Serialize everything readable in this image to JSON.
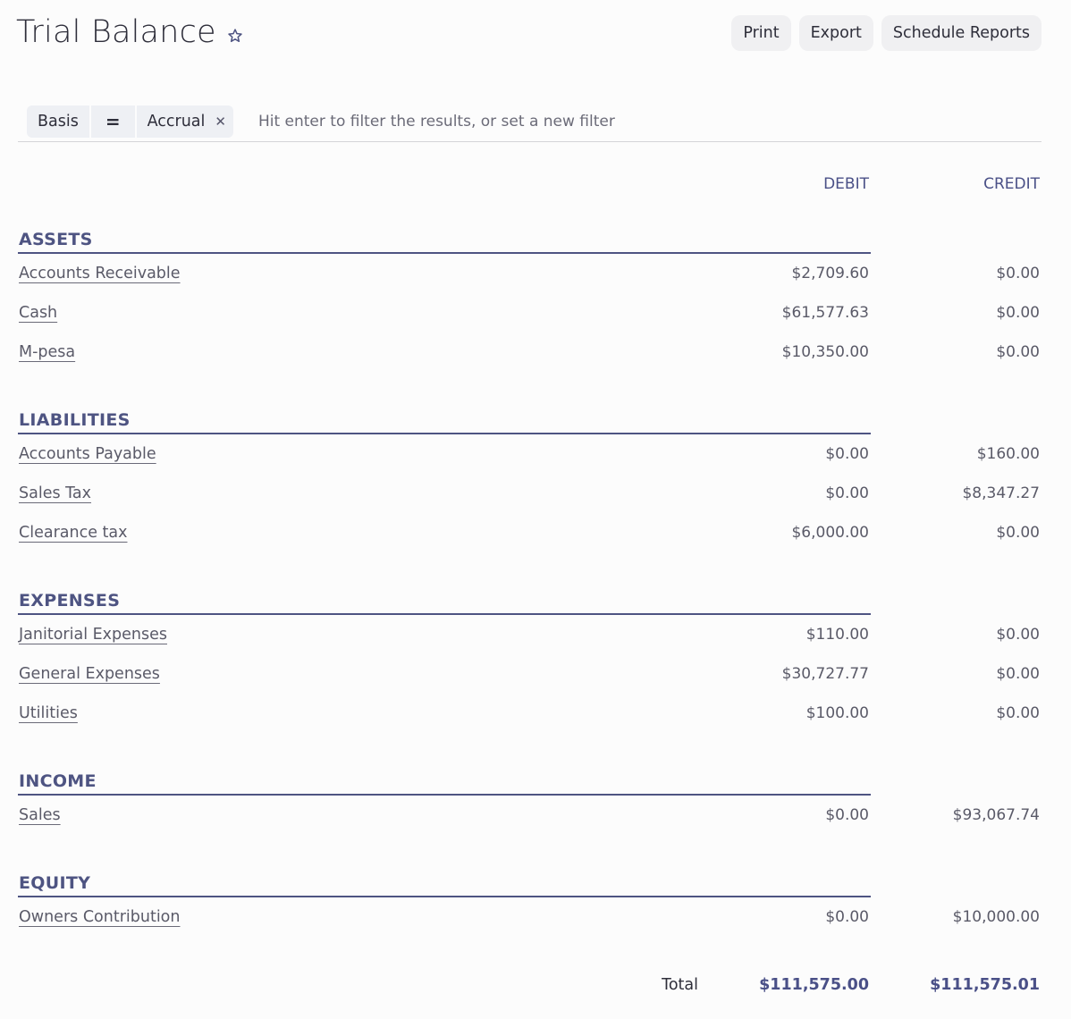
{
  "header": {
    "title": "Trial Balance",
    "favorite_icon": "star-icon",
    "buttons": {
      "print": "Print",
      "export": "Export",
      "schedule": "Schedule Reports"
    }
  },
  "filter": {
    "field": "Basis",
    "operator": "=",
    "value": "Accrual",
    "remove_icon": "close-icon",
    "placeholder": "Hit enter to filter the results, or set a new filter"
  },
  "columns": {
    "debit": "DEBIT",
    "credit": "CREDIT"
  },
  "sections": [
    {
      "title": "ASSETS",
      "rows": [
        {
          "account": "Accounts Receivable",
          "debit": "$2,709.60",
          "credit": "$0.00"
        },
        {
          "account": "Cash",
          "debit": "$61,577.63",
          "credit": "$0.00"
        },
        {
          "account": "M-pesa",
          "debit": "$10,350.00",
          "credit": "$0.00"
        }
      ]
    },
    {
      "title": "LIABILITIES",
      "rows": [
        {
          "account": "Accounts Payable",
          "debit": "$0.00",
          "credit": "$160.00"
        },
        {
          "account": "Sales Tax",
          "debit": "$0.00",
          "credit": "$8,347.27"
        },
        {
          "account": "Clearance tax",
          "debit": "$6,000.00",
          "credit": "$0.00"
        }
      ]
    },
    {
      "title": "EXPENSES",
      "rows": [
        {
          "account": "Janitorial Expenses",
          "debit": "$110.00",
          "credit": "$0.00"
        },
        {
          "account": "General Expenses",
          "debit": "$30,727.77",
          "credit": "$0.00"
        },
        {
          "account": "Utilities",
          "debit": "$100.00",
          "credit": "$0.00"
        }
      ]
    },
    {
      "title": "INCOME",
      "rows": [
        {
          "account": "Sales",
          "debit": "$0.00",
          "credit": "$93,067.74"
        }
      ]
    },
    {
      "title": "EQUITY",
      "rows": [
        {
          "account": "Owners Contribution",
          "debit": "$0.00",
          "credit": "$10,000.00"
        }
      ]
    }
  ],
  "totals": {
    "label": "Total",
    "debit": "$111,575.00",
    "credit": "$111,575.01"
  },
  "colors": {
    "accent": "#4e5482",
    "text": "#5a5a68"
  }
}
